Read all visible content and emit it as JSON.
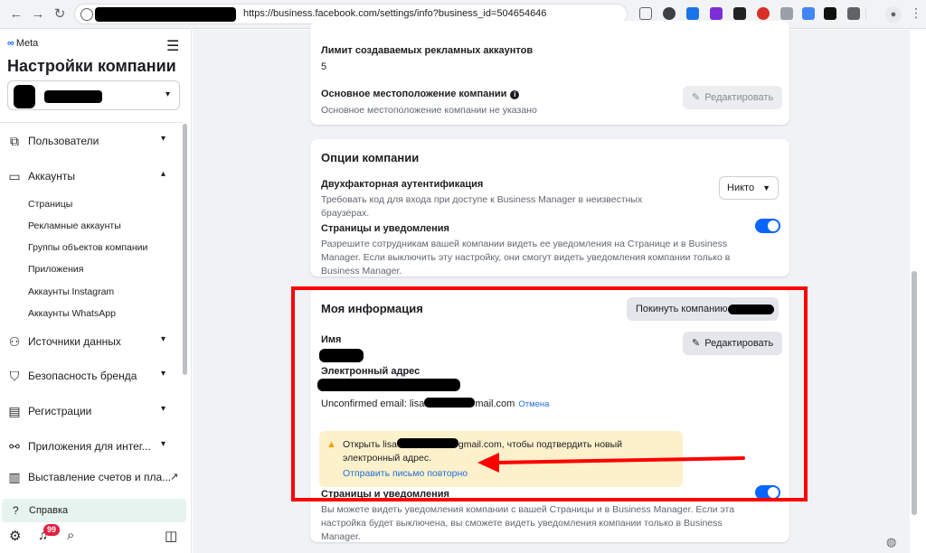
{
  "browser": {
    "url": "https://business.facebook.com/settings/info?business_id=504654646",
    "back_glyph": "←",
    "forward_glyph": "→",
    "reload_glyph": "↻",
    "menu_glyph": "⋮"
  },
  "sidebar": {
    "brand": "Meta",
    "brand_mark": "∞",
    "menu_glyph": "☰",
    "title": "Настройки компании",
    "caret_glyph": "▾",
    "items": [
      {
        "label": "Пользователи",
        "icon": "users-icon"
      },
      {
        "label": "Аккаунты",
        "icon": "folder-icon"
      },
      {
        "label": "Источники данных",
        "icon": "data-sources-icon"
      },
      {
        "label": "Безопасность бренда",
        "icon": "shield-icon"
      },
      {
        "label": "Регистрации",
        "icon": "clipboard-icon"
      },
      {
        "label": "Приложения для интег...",
        "icon": "integrations-icon"
      },
      {
        "label": "Выставление счетов и пла...",
        "icon": "billing-icon"
      }
    ],
    "account_subitems": [
      "Страницы",
      "Рекламные аккаунты",
      "Группы объектов компании",
      "Приложения",
      "Аккаунты Instagram",
      "Аккаунты WhatsApp"
    ],
    "help_label": "Справка",
    "notifications_count": "99"
  },
  "main": {
    "limits_card": {
      "ad_limit_label": "Лимит создаваемых рекламных аккаунтов",
      "ad_limit_value": "5",
      "location_label": "Основное местоположение компании",
      "location_desc": "Основное местоположение компании не указано",
      "edit_button": "Редактировать"
    },
    "options_card": {
      "title": "Опции компании",
      "twofa_label": "Двухфакторная аутентификация",
      "twofa_desc": "Требовать код для входа при доступе к Business Manager в неизвестных браузерах.",
      "twofa_value": "Никто",
      "pages_label": "Страницы и уведомления",
      "pages_desc": "Разрешите сотрудникам вашей компании видеть ее уведомления на Странице и в Business Manager. Если выключить эту настройку, они смогут видеть уведомления компании только в Business Manager.",
      "pages_toggle": "on"
    },
    "my_info_card": {
      "title": "Моя информация",
      "leave_button": "Покинуть компанию «",
      "name_label": "Имя",
      "edit_button": "Редактировать",
      "email_label": "Электронный адрес",
      "unconfirmed_prefix": "Unconfirmed email: lisa",
      "unconfirmed_suffix": "mail.com",
      "cancel_link": "Отмена",
      "warning_prefix": "Открыть lisa",
      "warning_suffix": "gmail.com, чтобы подтвердить новый электронный адрес.",
      "resend_link": "Отправить письмо повторно",
      "pages_label": "Страницы и уведомления",
      "pages_desc": "Вы можете видеть уведомления компании с вашей Страницы и в Business Manager. Если эта настройка будет выключена, вы сможете видеть уведомления компании только в Business Manager.",
      "pages_toggle": "on"
    }
  },
  "colors": {
    "highlight": "#ff0000",
    "toggle": "#0866ff",
    "link": "#216fdb",
    "warning_bg": "#fdf1cc"
  }
}
